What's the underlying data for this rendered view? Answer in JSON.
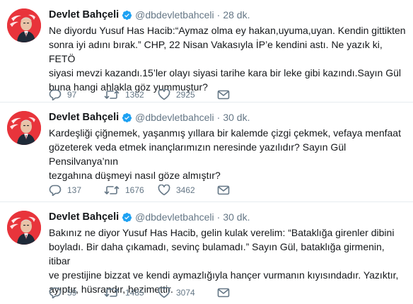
{
  "tweets": [
    {
      "author_name": "Devlet Bahçeli",
      "handle": "@dbdevletbahceli",
      "separator": "·",
      "time": "28 dk.",
      "text": "Ne diyordu Yusuf Has Hacib:“Aymaz olma ey hakan,uyuma,uyan. Kendin gittikten\nsonra iyi adını bırak.” CHP, 22 Nisan Vakasıyla İP’e kendini astı. Ne yazık ki, FETÖ\nsiyasi mevzi kazandı.15’ler olayı siyasi tarihe kara bir leke gibi kazındı.Sayın Gül\nbuna hangi ahlakla göz yummuştur?",
      "replies": "97",
      "retweets": "1362",
      "likes": "2925"
    },
    {
      "author_name": "Devlet Bahçeli",
      "handle": "@dbdevletbahceli",
      "separator": "·",
      "time": "30 dk.",
      "text": "Kardeşliği çiğnemek, yaşanmış yıllara bir kalemde çizgi çekmek, vefaya menfaat\ngözeterek veda etmek inançlarımızın neresinde yazılıdır? Sayın Gül Pensilvanya’nın\ntezgahına düşmeyi nasıl göze almıştır?",
      "replies": "137",
      "retweets": "1676",
      "likes": "3462"
    },
    {
      "author_name": "Devlet Bahçeli",
      "handle": "@dbdevletbahceli",
      "separator": "·",
      "time": "30 dk.",
      "text": "Bakınız ne diyor Yusuf Has Hacib, gelin kulak verelim: “Bataklığa girenler dibini\nboyladı. Bir daha çıkamadı, sevinç bulamadı.” Sayın Gül, bataklığa girmenin, itibar\nve prestijine bizzat ve kendi aymazlığıyla hançer vurmanın kıyısındadır. Yazıktır,\nayıptır, hüsrandır, hezimettir.",
      "replies": "59",
      "retweets": "1485",
      "likes": "3074"
    }
  ],
  "icons": {
    "verified": "verified-badge-icon",
    "reply": "reply-icon",
    "retweet": "retweet-icon",
    "like": "heart-icon",
    "message": "direct-message-icon"
  },
  "colors": {
    "text": "#14171a",
    "secondary": "#657786",
    "verified": "#1da1f2",
    "divider": "#e6ecf0",
    "avatar_background": "#e8343b"
  }
}
